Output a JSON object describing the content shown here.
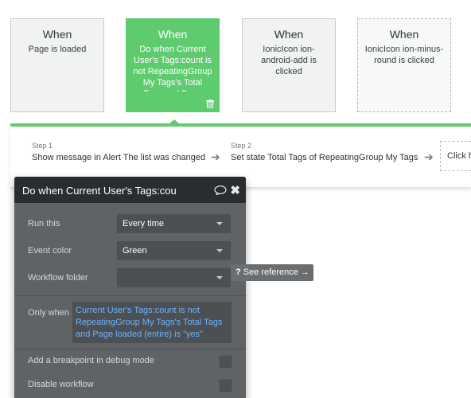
{
  "events": [
    {
      "when": "When",
      "condition": "Page is loaded"
    },
    {
      "when": "When",
      "condition": "Do when Current User's Tags:count is not RepeatingGroup My Tags's Total Tags and Page loaded (entire) is \"yes\""
    },
    {
      "when": "When",
      "condition": "IonicIcon ion-android-add is clicked"
    },
    {
      "when": "When",
      "condition": "IonicIcon ion-minus-round is clicked"
    }
  ],
  "steps": [
    {
      "number": "Step 1",
      "text": "Show message in Alert The list was changed"
    },
    {
      "number": "Step 2",
      "text": "Set state Total Tags of RepeatingGroup My Tags"
    }
  ],
  "add_step_text": "Click here to add an action...",
  "panel": {
    "title": "Do when Current User's Tags:cou",
    "run_this_label": "Run this",
    "run_this_value": "Every time",
    "event_color_label": "Event color",
    "event_color_value": "Green",
    "workflow_folder_label": "Workflow folder",
    "workflow_folder_value": "",
    "only_when_label": "Only when",
    "only_when_value": "Current User's Tags:count is not RepeatingGroup My Tags's Total Tags and Page loaded (entire) is \"yes\"",
    "breakpoint_label": "Add a breakpoint in debug mode",
    "disable_label": "Disable workflow"
  },
  "see_reference": {
    "icon": "?",
    "label": "See reference →"
  },
  "colors": {
    "accent_green": "#5fcb6f",
    "panel_bg": "#5f6366",
    "link_blue": "#6cb2ff"
  }
}
